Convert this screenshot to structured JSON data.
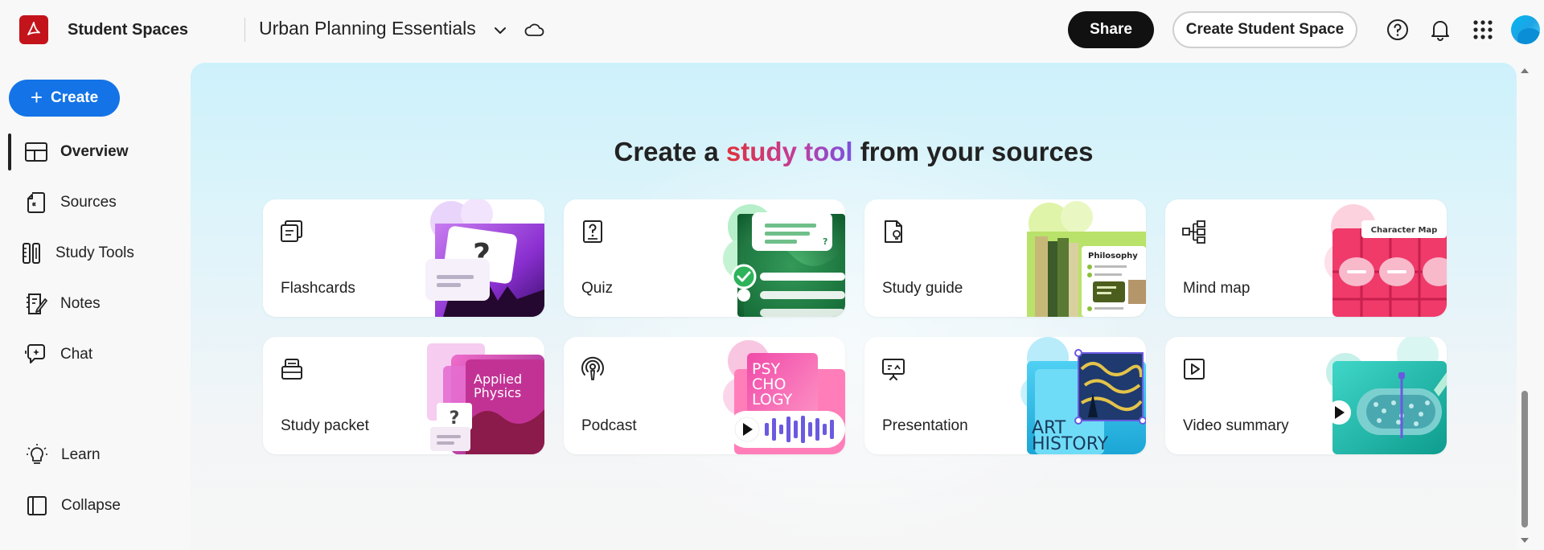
{
  "app": {
    "name": "Student Spaces",
    "space_title": "Urban Planning Essentials"
  },
  "toolbar": {
    "share_label": "Share",
    "create_space_label": "Create Student Space"
  },
  "sidebar": {
    "create_label": "Create",
    "items": [
      {
        "label": "Overview",
        "icon": "overview-icon",
        "active": true
      },
      {
        "label": "Sources",
        "icon": "sources-icon"
      },
      {
        "label": "Study Tools",
        "icon": "study-tools-icon"
      },
      {
        "label": "Notes",
        "icon": "notes-icon"
      },
      {
        "label": "Chat",
        "icon": "chat-icon"
      }
    ],
    "bottom": [
      {
        "label": "Learn",
        "icon": "lightbulb-icon"
      },
      {
        "label": "Collapse",
        "icon": "collapse-icon"
      }
    ]
  },
  "main": {
    "heading_before": "Create a",
    "heading_accent": "study tool",
    "heading_after": "from your sources",
    "cards": [
      {
        "label": "Flashcards",
        "icon": "flashcards-icon"
      },
      {
        "label": "Quiz",
        "icon": "quiz-icon"
      },
      {
        "label": "Study guide",
        "icon": "study-guide-icon"
      },
      {
        "label": "Mind map",
        "icon": "mind-map-icon"
      },
      {
        "label": "Study packet",
        "icon": "study-packet-icon"
      },
      {
        "label": "Podcast",
        "icon": "podcast-icon"
      },
      {
        "label": "Presentation",
        "icon": "presentation-icon"
      },
      {
        "label": "Video summary",
        "icon": "video-summary-icon"
      }
    ],
    "art_text": {
      "flashcards_q": "?",
      "quiz_q": "?",
      "philosophy": "Philosophy",
      "character_map": "Character Map",
      "applied_physics_1": "Applied",
      "applied_physics_2": "Physics",
      "packet_q": "?",
      "psych_1": "PSY",
      "psych_2": "CHO",
      "psych_3": "LOGY",
      "art_1": "ART",
      "art_2": "HISTORY"
    }
  },
  "colors": {
    "accent_blue": "#1473e6",
    "brand_red": "#c3141b",
    "share_black": "#111111"
  }
}
